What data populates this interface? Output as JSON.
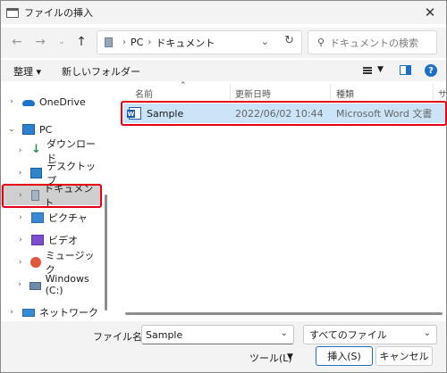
{
  "window": {
    "title": "ファイルの挿入"
  },
  "address": {
    "crumbs": [
      "PC",
      "ドキュメント"
    ]
  },
  "search": {
    "placeholder": "ドキュメントの検索"
  },
  "toolbar": {
    "organize": "整理 ▾",
    "new_folder": "新しいフォルダー",
    "help": "?"
  },
  "nav": {
    "items": [
      {
        "label": "OneDrive",
        "icon": "onedrive-icon"
      },
      {
        "label": "PC",
        "icon": "pc-icon"
      },
      {
        "label": "ダウンロード",
        "icon": "download-icon"
      },
      {
        "label": "デスクトップ",
        "icon": "desktop-icon"
      },
      {
        "label": "ドキュメント",
        "icon": "documents-icon",
        "selected": true
      },
      {
        "label": "ピクチャ",
        "icon": "pictures-icon"
      },
      {
        "label": "ビデオ",
        "icon": "videos-icon"
      },
      {
        "label": "ミュージック",
        "icon": "music-icon"
      },
      {
        "label": "Windows (C:)",
        "icon": "drive-icon"
      },
      {
        "label": "ネットワーク",
        "icon": "network-icon"
      }
    ]
  },
  "columns": {
    "name": "名前",
    "modified": "更新日時",
    "type": "種類",
    "size": "サ"
  },
  "files": [
    {
      "name": "Sample",
      "modified": "2022/06/02 10:44",
      "type": "Microsoft Word 文書",
      "icon": "word-document-icon"
    }
  ],
  "footer": {
    "filename_label": "ファイル名(N):",
    "filename_value": "Sample",
    "filetype_value": "すべてのファイル",
    "tools_label": "ツール(L)",
    "insert_label": "挿入(S)",
    "cancel_label": "キャンセル"
  },
  "colors": {
    "highlight": "#e60012",
    "selection": "#cce4f7",
    "accent": "#1e6fc5"
  }
}
